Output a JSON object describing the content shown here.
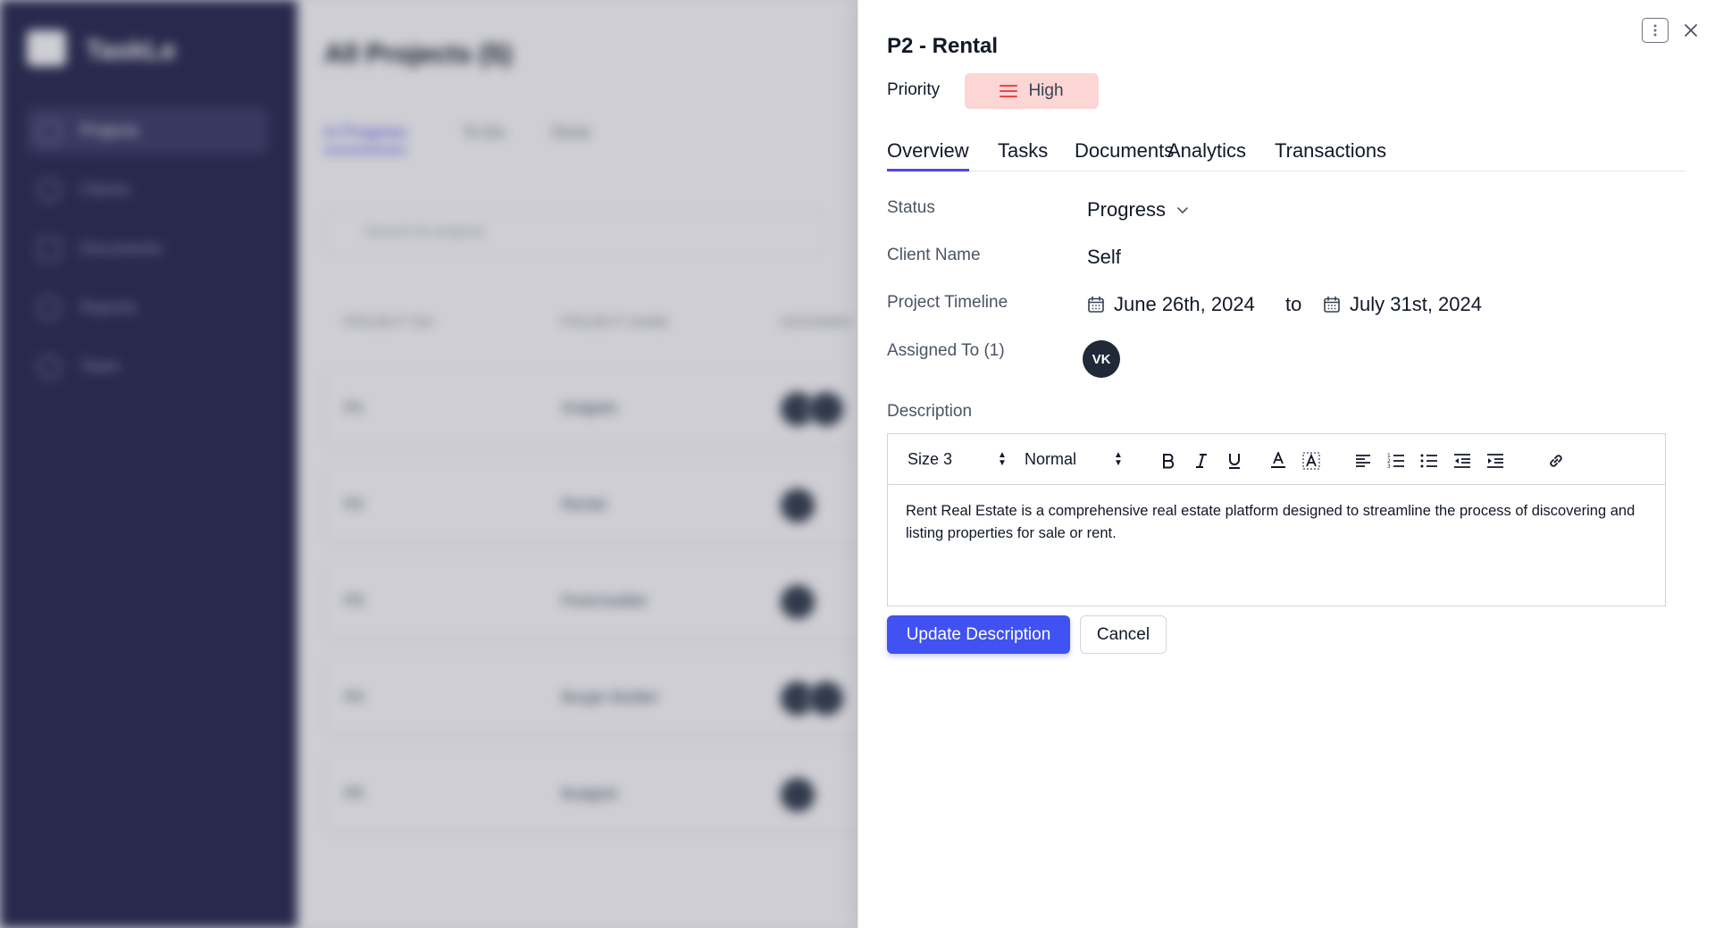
{
  "background": {
    "brand": "TaskLe",
    "nav": [
      "Projects",
      "Clients",
      "Documents",
      "Reports",
      "Team"
    ],
    "page_title": "All Projects (5)",
    "tabs": [
      "In Progress",
      "To Do",
      "Done"
    ],
    "search_placeholder": "Search for projects",
    "columns": [
      "PROJECT NO.",
      "PROJECT NAME",
      "ASSIGNED"
    ],
    "rows": [
      {
        "no": "P1",
        "name": "Gulgetic"
      },
      {
        "no": "P2",
        "name": "Rental"
      },
      {
        "no": "P3",
        "name": "Pond builder"
      },
      {
        "no": "P4",
        "name": "Burger Builder"
      },
      {
        "no": "P5",
        "name": "Budgets"
      }
    ]
  },
  "drawer": {
    "title": "P2 - Rental",
    "priority_label": "Priority",
    "priority_value": "High",
    "tabs": [
      "Overview",
      "Tasks",
      "Documents",
      "Analytics",
      "Transactions"
    ],
    "active_tab": "Overview",
    "fields": {
      "status_label": "Status",
      "status_value": "Progress",
      "client_label": "Client Name",
      "client_value": "Self",
      "timeline_label": "Project Timeline",
      "timeline_start": "June 26th, 2024",
      "timeline_sep": "to",
      "timeline_end": "July 31st, 2024",
      "assigned_label": "Assigned To (1)",
      "assignee_initials": "VK"
    },
    "description_label": "Description",
    "editor": {
      "size_select": "Size 3",
      "format_select": "Normal",
      "content": "Rent Real Estate is a comprehensive real estate platform designed to streamline the process of discovering and listing properties for sale or rent."
    },
    "buttons": {
      "update": "Update Description",
      "cancel": "Cancel"
    }
  },
  "colors": {
    "accent": "#4052f2",
    "priority_bg": "#fcd5d5",
    "priority_icon": "#ef4444",
    "sidebar": "#2b2d52"
  }
}
